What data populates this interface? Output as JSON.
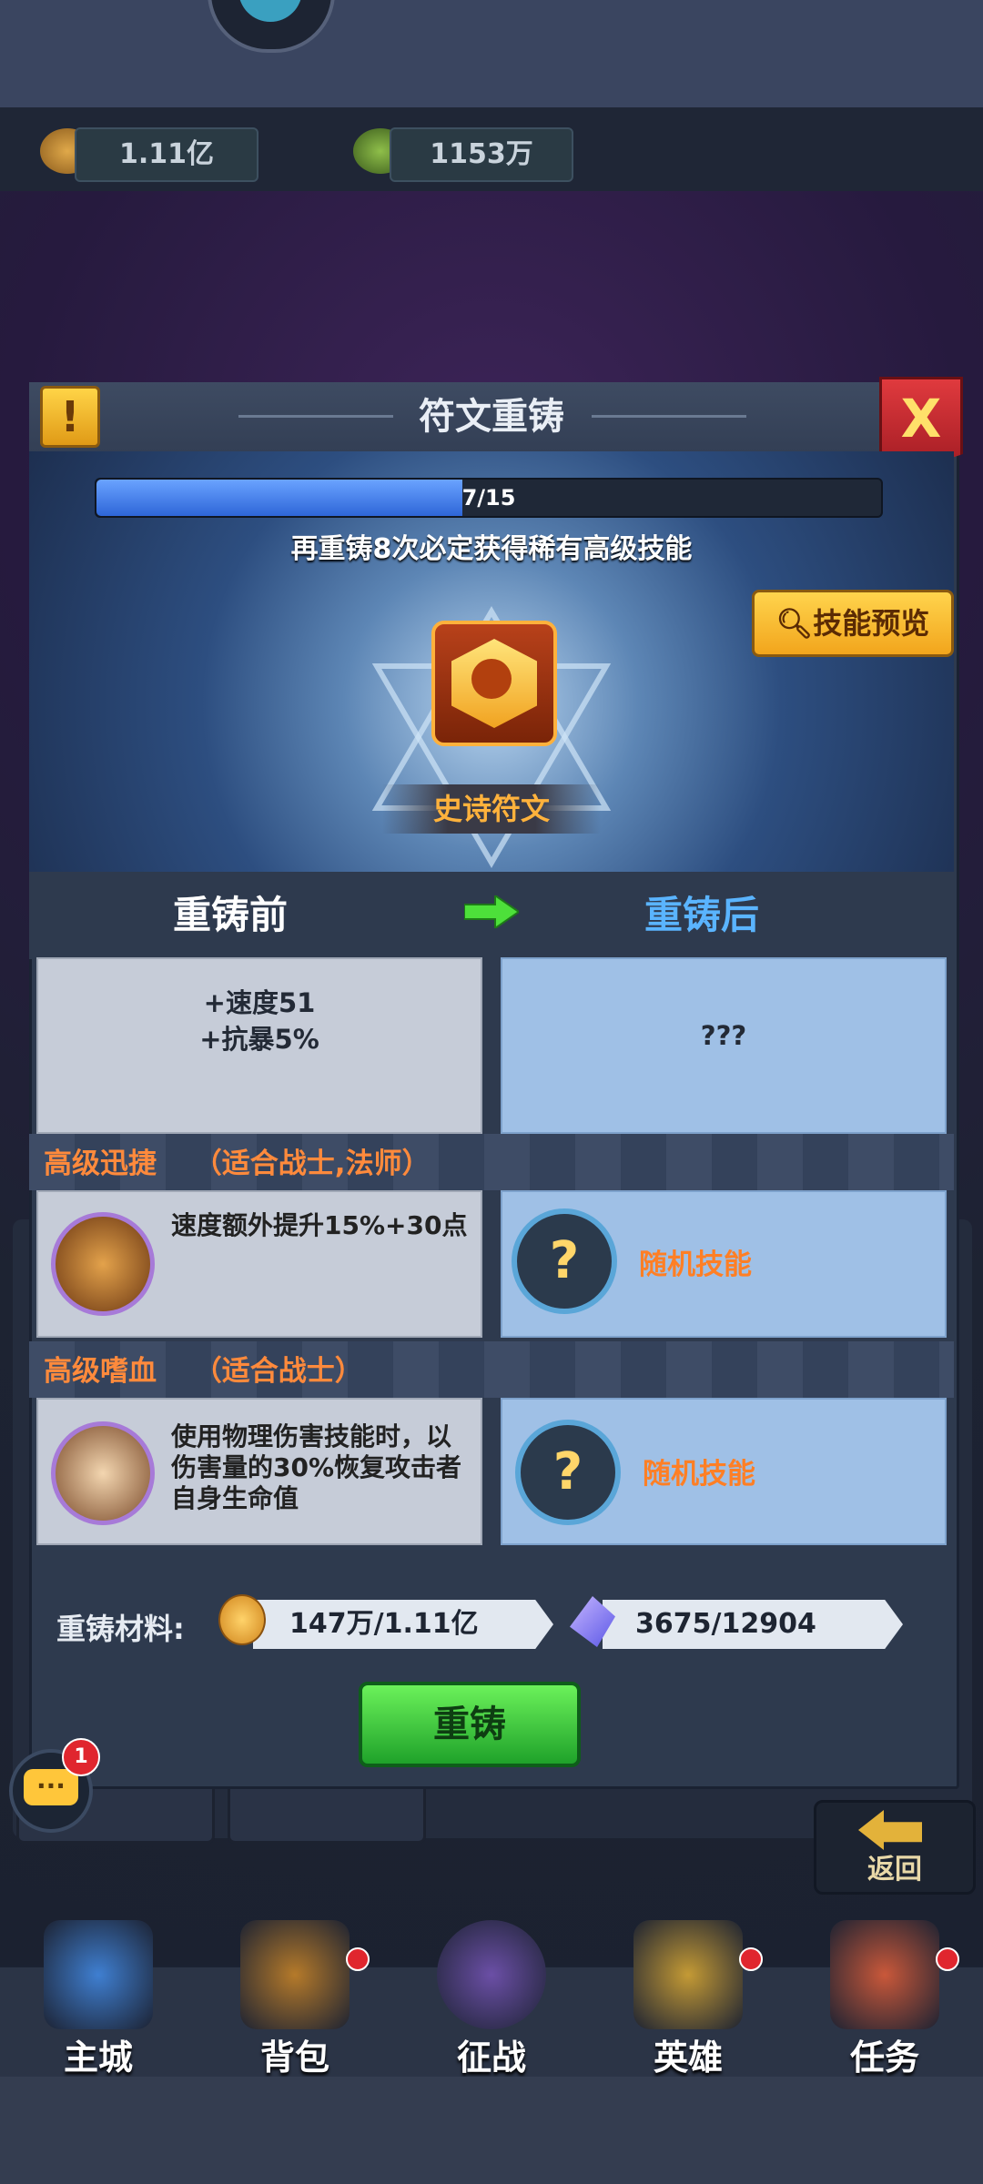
{
  "resources": {
    "gold": "1.11亿",
    "ore": "1153万"
  },
  "dialog": {
    "title": "符文重铸",
    "close_label": "X",
    "warning_label": "!",
    "progress": {
      "text": "7/15",
      "current": 7,
      "total": 15
    },
    "hint": "再重铸8次必定获得稀有高级技能",
    "preview_button": "技能预览",
    "rune_name": "史诗符文",
    "before_title": "重铸前",
    "after_title": "重铸后",
    "before_stats": [
      "+速度51",
      "+抗暴5%"
    ],
    "after_stats": "???",
    "skills": [
      {
        "name": "高级迅捷",
        "suit": "（适合战士,法师）",
        "desc": "速度额外提升15%+30点",
        "after": "随机技能"
      },
      {
        "name": "高级嗜血",
        "suit": "（适合战士）",
        "desc": "使用物理伤害技能时，以伤害量的30%恢复攻击者自身生命值",
        "after": "随机技能"
      }
    ],
    "materials_label": "重铸材料:",
    "material_gold": "147万/1.11亿",
    "material_crystal": "3675/12904",
    "recast_button": "重铸"
  },
  "chat": {
    "badge": "1",
    "icon": "chat-icon"
  },
  "return_label": "返回",
  "nav": [
    {
      "label": "主城",
      "dot": false,
      "color": "#3f7fd1"
    },
    {
      "label": "背包",
      "dot": true,
      "color": "#b57a2a"
    },
    {
      "label": "征战",
      "dot": false,
      "color": "#6b4fa6"
    },
    {
      "label": "英雄",
      "dot": true,
      "color": "#c49a35"
    },
    {
      "label": "任务",
      "dot": true,
      "color": "#c9583a"
    }
  ]
}
